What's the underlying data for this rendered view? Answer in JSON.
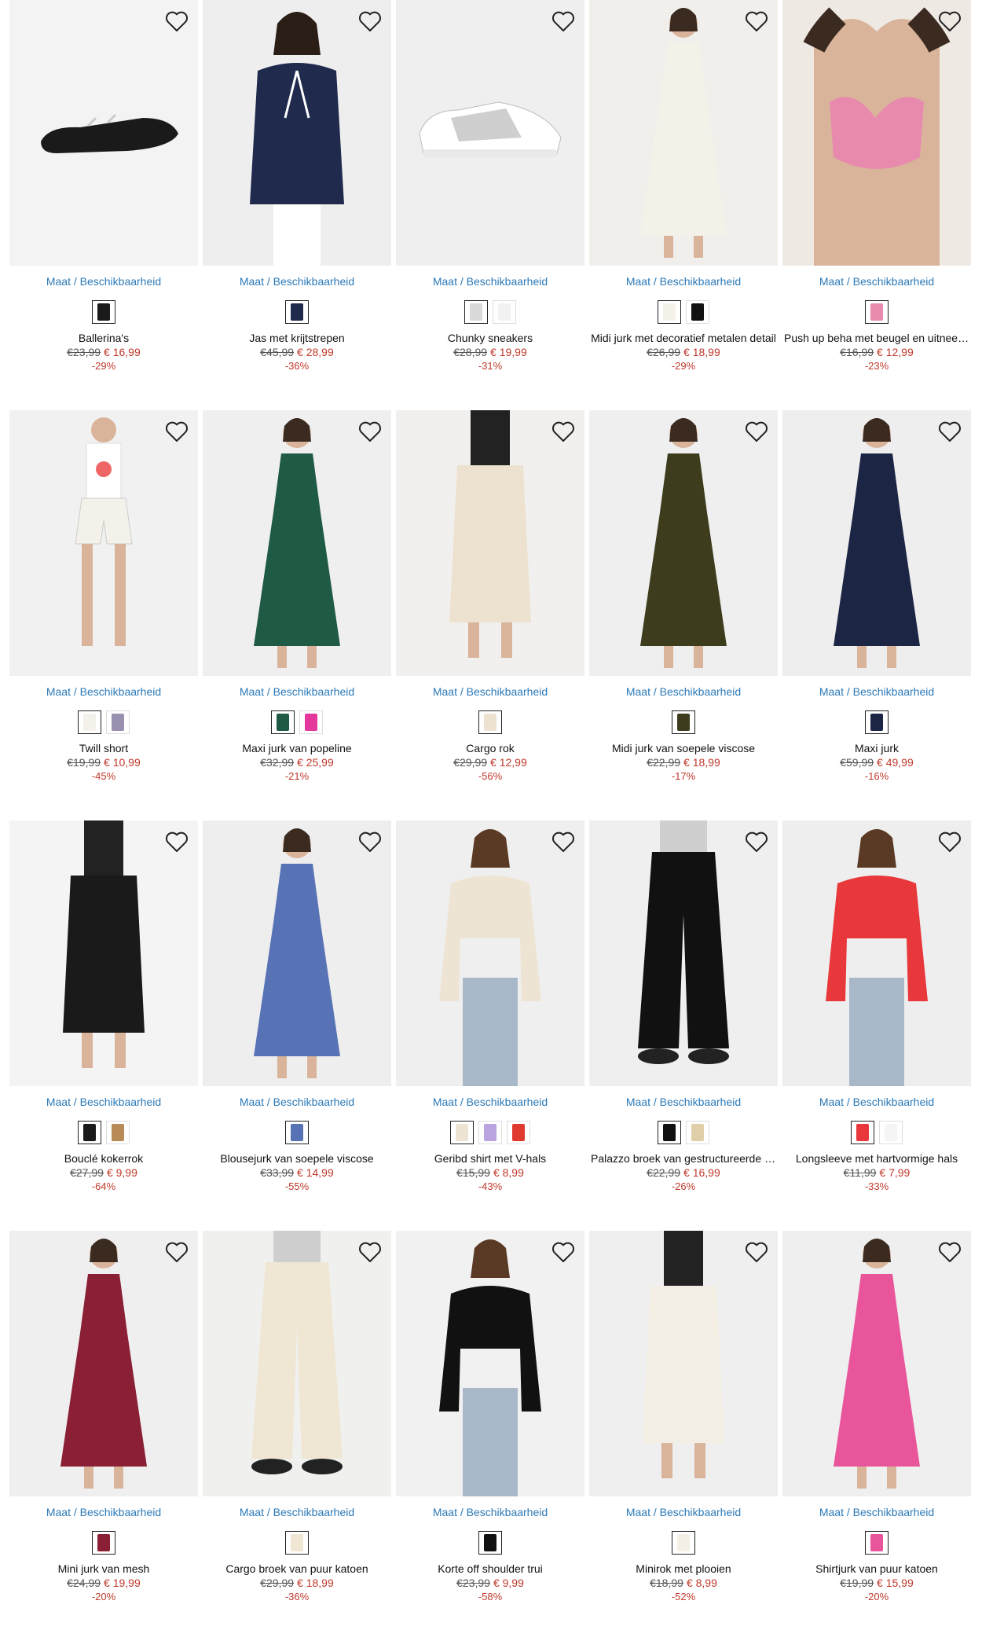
{
  "availability_label": "Maat / Beschikbaarheid",
  "wishlist_icon": "heart-outline-icon",
  "products": [
    {
      "name": "Ballerina's",
      "old_price": "€23,99",
      "new_price": "€ 16,99",
      "discount": "-29%",
      "bg": "#f3f3f3",
      "item": "shoe",
      "color": "#1a1a1a",
      "swatches": [
        "#1a1a1a"
      ]
    },
    {
      "name": "Jas met krijtstrepen",
      "old_price": "€45,99",
      "new_price": "€ 28,99",
      "discount": "-36%",
      "bg": "#eeeeee",
      "item": "jacket",
      "color": "#1f2a4d",
      "swatches": [
        "#1f2a4d"
      ]
    },
    {
      "name": "Chunky sneakers",
      "old_price": "€28,99",
      "new_price": "€ 19,99",
      "discount": "-31%",
      "bg": "#efefef",
      "item": "sneaker",
      "color": "#cfcfcf",
      "swatches": [
        "#d9d9d9",
        "#f2f2f2"
      ]
    },
    {
      "name": "Midi jurk met decoratief metalen detail",
      "old_price": "€26,99",
      "new_price": "€ 18,99",
      "discount": "-29%",
      "bg": "#f0efec",
      "item": "dress",
      "color": "#f4f1e8",
      "swatches": [
        "#f4f1e8",
        "#111111"
      ]
    },
    {
      "name": "Push up beha met beugel en uitneembare pads",
      "old_price": "€16,99",
      "new_price": "€ 12,99",
      "discount": "-23%",
      "bg": "#efe9e4",
      "item": "bra",
      "color": "#e889ae",
      "swatches": [
        "#e889ae"
      ]
    },
    {
      "name": "Twill short",
      "old_price": "€19,99",
      "new_price": "€ 10,99",
      "discount": "-45%",
      "bg": "#f1f1f1",
      "item": "short",
      "color": "#f3f1ea",
      "swatches": [
        "#f3f1ea",
        "#9a90b0"
      ]
    },
    {
      "name": "Maxi jurk van popeline",
      "old_price": "€32,99",
      "new_price": "€ 25,99",
      "discount": "-21%",
      "bg": "#efefef",
      "item": "dress",
      "color": "#1f5a44",
      "swatches": [
        "#1f5a44",
        "#e3379b"
      ]
    },
    {
      "name": "Cargo rok",
      "old_price": "€29,99",
      "new_price": "€ 12,99",
      "discount": "-56%",
      "bg": "#f2f0ee",
      "item": "skirt",
      "color": "#ede2d0",
      "swatches": [
        "#ede2d0"
      ]
    },
    {
      "name": "Midi jurk van soepele viscose",
      "old_price": "€22,99",
      "new_price": "€ 18,99",
      "discount": "-17%",
      "bg": "#efefef",
      "item": "dress",
      "color": "#3d3d1e",
      "swatches": [
        "#3d3d1e"
      ]
    },
    {
      "name": "Maxi jurk",
      "old_price": "€59,99",
      "new_price": "€ 49,99",
      "discount": "-16%",
      "bg": "#eeeeee",
      "item": "dress",
      "color": "#1d2545",
      "swatches": [
        "#1d2545"
      ]
    },
    {
      "name": "Bouclé kokerrok",
      "old_price": "€27,99",
      "new_price": "€ 9,99",
      "discount": "-64%",
      "bg": "#f4f4f4",
      "item": "skirt",
      "color": "#1a1a1a",
      "swatches": [
        "#1a1a1a",
        "#b88a55"
      ]
    },
    {
      "name": "Blousejurk van soepele viscose",
      "old_price": "€33,99",
      "new_price": "€ 14,99",
      "discount": "-55%",
      "bg": "#eeeeee",
      "item": "dress",
      "color": "#5873b5",
      "swatches": [
        "#5873b5"
      ]
    },
    {
      "name": "Geribd shirt met V-hals",
      "old_price": "€15,99",
      "new_price": "€ 8,99",
      "discount": "-43%",
      "bg": "#efefef",
      "item": "top",
      "color": "#eee4d3",
      "swatches": [
        "#eee4d3",
        "#b9a4e0",
        "#e0392f"
      ]
    },
    {
      "name": "Palazzo broek van gestructureerde stof",
      "old_price": "€22,99",
      "new_price": "€ 16,99",
      "discount": "-26%",
      "bg": "#efefef",
      "item": "pants",
      "color": "#111111",
      "swatches": [
        "#111111",
        "#e0cfa8"
      ]
    },
    {
      "name": "Longsleeve met hartvormige hals",
      "old_price": "€11,99",
      "new_price": "€ 7,99",
      "discount": "-33%",
      "bg": "#eeeeee",
      "item": "top",
      "color": "#e8383c",
      "swatches": [
        "#e8383c",
        "#f5f5f5"
      ]
    },
    {
      "name": "Mini jurk van mesh",
      "old_price": "€24,99",
      "new_price": "€ 19,99",
      "discount": "-20%",
      "bg": "#efefef",
      "item": "dress",
      "color": "#8a1f35",
      "swatches": [
        "#8a1f35"
      ]
    },
    {
      "name": "Cargo broek van puur katoen",
      "old_price": "€29,99",
      "new_price": "€ 18,99",
      "discount": "-36%",
      "bg": "#f0f0ee",
      "item": "pants",
      "color": "#efe6d3",
      "swatches": [
        "#efe6d3"
      ]
    },
    {
      "name": "Korte off shoulder trui",
      "old_price": "€23,99",
      "new_price": "€ 9,99",
      "discount": "-58%",
      "bg": "#f1f1f1",
      "item": "top",
      "color": "#111111",
      "swatches": [
        "#111111"
      ]
    },
    {
      "name": "Minirok met plooien",
      "old_price": "€18,99",
      "new_price": "€ 8,99",
      "discount": "-52%",
      "bg": "#efefef",
      "item": "skirt",
      "color": "#f3efe4",
      "swatches": [
        "#f3efe4"
      ]
    },
    {
      "name": "Shirtjurk van puur katoen",
      "old_price": "€19,99",
      "new_price": "€ 15,99",
      "discount": "-20%",
      "bg": "#efefef",
      "item": "dress",
      "color": "#e9559b",
      "swatches": [
        "#e9559b"
      ]
    }
  ]
}
